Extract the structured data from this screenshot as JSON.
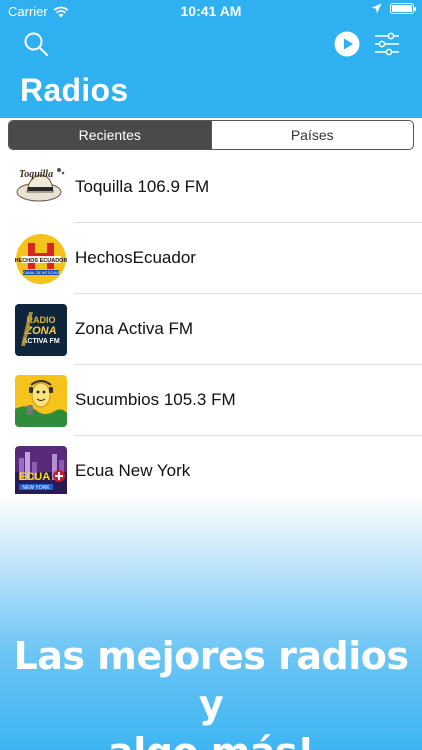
{
  "status_bar": {
    "carrier": "Carrier",
    "time": "10:41 AM"
  },
  "header": {
    "title": "Radios",
    "icons": [
      "search-icon",
      "play-icon",
      "filter-icon"
    ],
    "background": "#2fb0f0"
  },
  "segmented": {
    "tabs": [
      {
        "label": "Recientes",
        "selected": true
      },
      {
        "label": "Países",
        "selected": false
      }
    ]
  },
  "stations": [
    {
      "name": "Toquilla 106.9 FM",
      "logo_icon": "toquilla-logo"
    },
    {
      "name": "HechosEcuador",
      "logo_icon": "hechos-ecuador-logo"
    },
    {
      "name": "Zona Activa FM",
      "logo_icon": "zona-activa-logo"
    },
    {
      "name": "Sucumbios 105.3 FM",
      "logo_icon": "sucumbios-logo"
    },
    {
      "name": "Ecua New York",
      "logo_icon": "ecua-new-york-logo"
    }
  ],
  "footer": {
    "tagline_line1": "Las mejores radios y",
    "tagline_line2": "algo más!"
  }
}
